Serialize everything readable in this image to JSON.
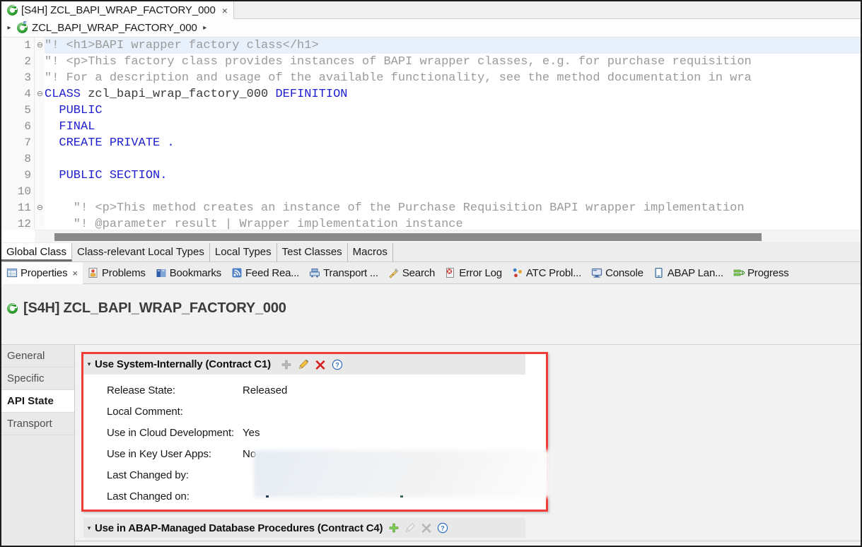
{
  "editor_tab": {
    "title": "[S4H] ZCL_BAPI_WRAP_FACTORY_000",
    "close": "×",
    "icon": "abap-class-icon"
  },
  "breadcrumb": {
    "expand_arrow": "▸",
    "label": "ZCL_BAPI_WRAP_FACTORY_000",
    "next_arrow": "▸",
    "icon": "abap-class-factory-icon"
  },
  "code": {
    "lines": [
      {
        "n": "1",
        "fold": "⊖",
        "highlight": true,
        "tokens": [
          {
            "t": "\"! <h1>BAPI wrapper factory class</h1>",
            "c": "com"
          }
        ]
      },
      {
        "n": "2",
        "fold": "",
        "highlight": false,
        "tokens": [
          {
            "t": "\"! <p>This factory class provides instances of BAPI wrapper classes, e.g. for purchase requisition",
            "c": "com"
          }
        ]
      },
      {
        "n": "3",
        "fold": "",
        "highlight": false,
        "tokens": [
          {
            "t": "\"! For a description and usage of the available functionality, see the method documentation in wra",
            "c": "com"
          }
        ]
      },
      {
        "n": "4",
        "fold": "⊖",
        "highlight": false,
        "tokens": [
          {
            "t": "CLASS",
            "c": "kw"
          },
          {
            "t": " zcl_bapi_wrap_factory_000 ",
            "c": "id"
          },
          {
            "t": "DEFINITION",
            "c": "kw"
          }
        ]
      },
      {
        "n": "5",
        "fold": "",
        "highlight": false,
        "tokens": [
          {
            "t": "  ",
            "c": "id"
          },
          {
            "t": "PUBLIC",
            "c": "kw"
          }
        ]
      },
      {
        "n": "6",
        "fold": "",
        "highlight": false,
        "tokens": [
          {
            "t": "  ",
            "c": "id"
          },
          {
            "t": "FINAL",
            "c": "kw"
          }
        ]
      },
      {
        "n": "7",
        "fold": "",
        "highlight": false,
        "tokens": [
          {
            "t": "  ",
            "c": "id"
          },
          {
            "t": "CREATE PRIVATE .",
            "c": "kw"
          }
        ]
      },
      {
        "n": "8",
        "fold": "",
        "highlight": false,
        "tokens": [
          {
            "t": "",
            "c": "id"
          }
        ]
      },
      {
        "n": "9",
        "fold": "",
        "highlight": false,
        "tokens": [
          {
            "t": "  ",
            "c": "id"
          },
          {
            "t": "PUBLIC SECTION.",
            "c": "kw"
          }
        ]
      },
      {
        "n": "10",
        "fold": "",
        "highlight": false,
        "tokens": [
          {
            "t": "",
            "c": "id"
          }
        ]
      },
      {
        "n": "11",
        "fold": "⊖",
        "highlight": false,
        "tokens": [
          {
            "t": "    \"! <p>This method creates an instance of the Purchase Requisition BAPI wrapper implementation",
            "c": "com"
          }
        ]
      },
      {
        "n": "12",
        "fold": "",
        "highlight": false,
        "tokens": [
          {
            "t": "    \"! @parameter result | Wrapper implementation instance",
            "c": "com"
          }
        ]
      }
    ]
  },
  "source_tabs": [
    {
      "label": "Global Class",
      "active": true
    },
    {
      "label": "Class-relevant Local Types",
      "active": false
    },
    {
      "label": "Local Types",
      "active": false
    },
    {
      "label": "Test Classes",
      "active": false
    },
    {
      "label": "Macros",
      "active": false
    }
  ],
  "view_tabs": [
    {
      "label": "Properties",
      "icon": "properties-icon",
      "active": true,
      "close": "×"
    },
    {
      "label": "Problems",
      "icon": "problems-icon",
      "active": false,
      "close": ""
    },
    {
      "label": "Bookmarks",
      "icon": "bookmarks-icon",
      "active": false,
      "close": ""
    },
    {
      "label": "Feed Rea...",
      "icon": "feed-reader-icon",
      "active": false,
      "close": ""
    },
    {
      "label": "Transport ...",
      "icon": "transport-icon",
      "active": false,
      "close": ""
    },
    {
      "label": "Search",
      "icon": "search-icon",
      "active": false,
      "close": ""
    },
    {
      "label": "Error Log",
      "icon": "error-log-icon",
      "active": false,
      "close": ""
    },
    {
      "label": "ATC Probl...",
      "icon": "atc-problems-icon",
      "active": false,
      "close": ""
    },
    {
      "label": "Console",
      "icon": "console-icon",
      "active": false,
      "close": ""
    },
    {
      "label": "ABAP Lan...",
      "icon": "abap-language-icon",
      "active": false,
      "close": ""
    },
    {
      "label": "Progress",
      "icon": "progress-icon",
      "active": false,
      "close": ""
    }
  ],
  "properties": {
    "title": "[S4H] ZCL_BAPI_WRAP_FACTORY_000",
    "title_icon": "abap-class-icon",
    "side_tabs": [
      {
        "label": "General",
        "active": false
      },
      {
        "label": "Specific",
        "active": false
      },
      {
        "label": "API State",
        "active": true
      },
      {
        "label": "Transport",
        "active": false
      }
    ],
    "section_c1": {
      "caret": "▾",
      "title": "Use System-Internally (Contract C1)",
      "actions": [
        {
          "name": "add-icon",
          "label": "Add"
        },
        {
          "name": "edit-icon",
          "label": "Edit"
        },
        {
          "name": "delete-icon",
          "label": "Delete"
        },
        {
          "name": "help-icon",
          "label": "Help"
        }
      ],
      "rows": [
        {
          "label": "Release State:",
          "value": "Released",
          "redacted": false
        },
        {
          "label": "Local Comment:",
          "value": "",
          "redacted": false
        },
        {
          "label": "Use in Cloud Development:",
          "value": "Yes",
          "redacted": false
        },
        {
          "label": "Use in Key User Apps:",
          "value": "No",
          "redacted": false
        },
        {
          "label": "Last Changed by:",
          "value": "",
          "redacted": true
        },
        {
          "label": "Last Changed on:",
          "value": "",
          "redacted": true
        }
      ]
    },
    "section_c4": {
      "caret": "▾",
      "title": "Use in ABAP-Managed Database Procedures (Contract C4)",
      "actions": [
        {
          "name": "add-icon",
          "label": "Add"
        },
        {
          "name": "edit-icon",
          "label": "Edit"
        },
        {
          "name": "delete-icon",
          "label": "Delete"
        },
        {
          "name": "help-icon",
          "label": "Help"
        }
      ]
    }
  },
  "colors": {
    "highlight_border": "#f03b36",
    "keyword": "#2020d0",
    "comment": "#9b9b9b",
    "panel_bg": "#f2f2f2",
    "header_bg": "#e8e8e8",
    "accent_green": "#2f9e2f",
    "accent_red": "#d41f1f",
    "accent_blue": "#2f6fbf",
    "scrollbar": "#8a8a8a"
  }
}
